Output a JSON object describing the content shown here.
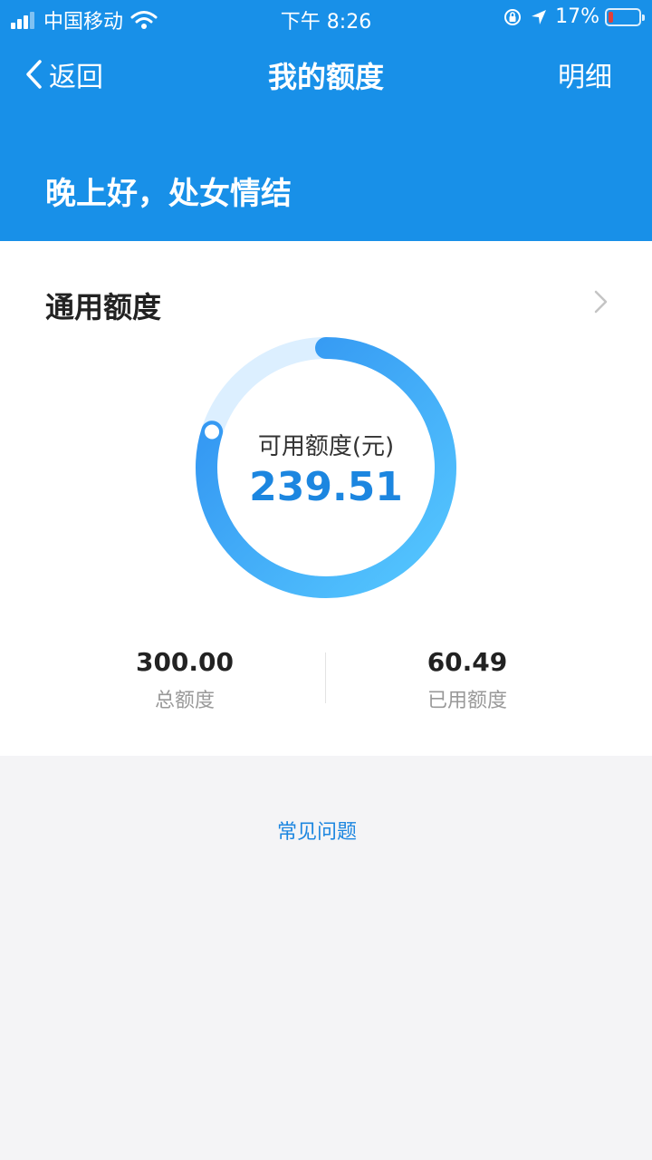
{
  "status_bar": {
    "carrier": "中国移动",
    "time": "下午 8:26",
    "battery_percent": "17%",
    "battery_level": 0.17,
    "icons": [
      "signal-icon",
      "wifi-icon",
      "orientation-lock-icon",
      "location-arrow-icon",
      "battery-icon"
    ]
  },
  "nav": {
    "back_label": "返回",
    "title": "我的额度",
    "detail_label": "明细"
  },
  "greeting": "晚上好，处女情结",
  "card": {
    "title": "通用额度",
    "ring": {
      "label": "可用额度(元)",
      "value": "239.51",
      "available_fraction": 0.7984
    },
    "stats": [
      {
        "value": "300.00",
        "label": "总额度"
      },
      {
        "value": "60.49",
        "label": "已用额度"
      }
    ]
  },
  "faq_label": "常见问题",
  "colors": {
    "header_blue": "#1890e8",
    "accent_blue": "#1c86e0",
    "ring_track": "#dcefff",
    "ring_start": "#56c8ff",
    "ring_end": "#2e8ff0",
    "page_bg": "#f4f4f6"
  }
}
